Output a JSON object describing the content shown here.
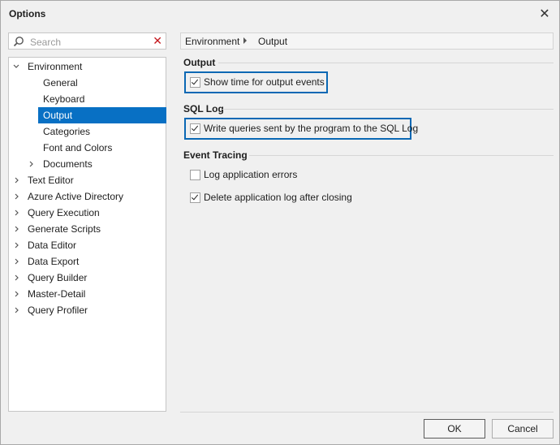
{
  "window": {
    "title": "Options",
    "close_icon": "close-icon"
  },
  "search": {
    "placeholder": "Search",
    "value": ""
  },
  "tree": {
    "items": [
      {
        "label": "Environment",
        "expanded": true
      },
      {
        "label": "General"
      },
      {
        "label": "Keyboard"
      },
      {
        "label": "Output",
        "selected": true
      },
      {
        "label": "Categories"
      },
      {
        "label": "Font and Colors"
      },
      {
        "label": "Documents",
        "expanded": false
      },
      {
        "label": "Text Editor"
      },
      {
        "label": "Azure Active Directory"
      },
      {
        "label": "Query Execution"
      },
      {
        "label": "Generate Scripts"
      },
      {
        "label": "Data Editor"
      },
      {
        "label": "Data Export"
      },
      {
        "label": "Query Builder"
      },
      {
        "label": "Master-Detail"
      },
      {
        "label": "Query Profiler"
      }
    ]
  },
  "breadcrumb": {
    "root": "Environment",
    "current": "Output"
  },
  "groups": {
    "output": {
      "title": "Output",
      "show_time": {
        "label": "Show time for output events",
        "checked": true
      }
    },
    "sql_log": {
      "title": "SQL Log",
      "write_queries": {
        "label": "Write queries sent by the program to the SQL Log",
        "checked": true
      }
    },
    "event_tracing": {
      "title": "Event Tracing",
      "log_errors": {
        "label": "Log application errors",
        "checked": false
      },
      "delete_log": {
        "label": "Delete application log after closing",
        "checked": true
      }
    }
  },
  "buttons": {
    "ok": "OK",
    "cancel": "Cancel"
  },
  "colors": {
    "selection": "#0870c4",
    "highlight_border": "#0a68b4",
    "clear_icon": "#c4161c"
  }
}
